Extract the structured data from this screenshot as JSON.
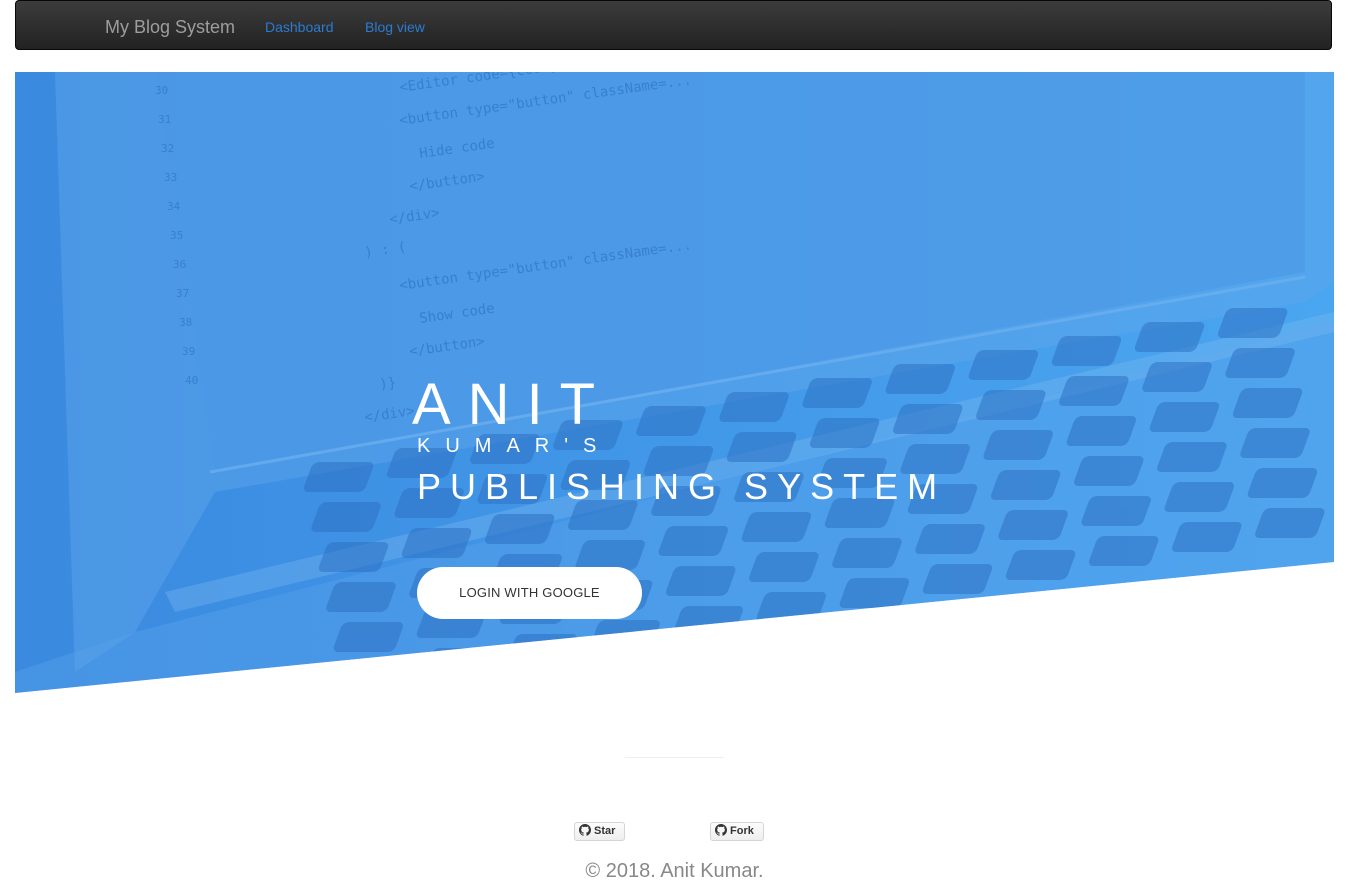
{
  "navbar": {
    "brand": "My Blog System",
    "links": [
      "Dashboard",
      "Blog view"
    ]
  },
  "hero": {
    "title_line1": "ANIT",
    "title_line2": "KUMAR'S",
    "title_line3": "PUBLISHING SYSTEM",
    "login_label": "LOGIN WITH GOOGLE",
    "background_color": "#3f92e6",
    "background_image": "laptop-keyboard-code-photo"
  },
  "footer": {
    "star_label": "Star",
    "fork_label": "Fork",
    "github_icon": "github-icon",
    "copyright": "© 2018. Anit Kumar."
  },
  "colors": {
    "navbar_bg": "#222222",
    "brand_text": "#9d9d9d",
    "link": "#2a7bd1",
    "hero_blue": "#3f92e6",
    "copyright_text": "#888888"
  },
  "code_snippet": [
    "<Editor code={code} />",
    "<button type=\"button\" className=...",
    "Hide code",
    "</button>",
    "</div>",
    ") : (",
    "<button type=\"button\" className=...",
    "Show code",
    "</button>",
    ")}",
    "</div>"
  ],
  "code_line_numbers": [
    "30",
    "31",
    "32",
    "33",
    "34",
    "35",
    "36",
    "37",
    "38",
    "39",
    "40"
  ]
}
